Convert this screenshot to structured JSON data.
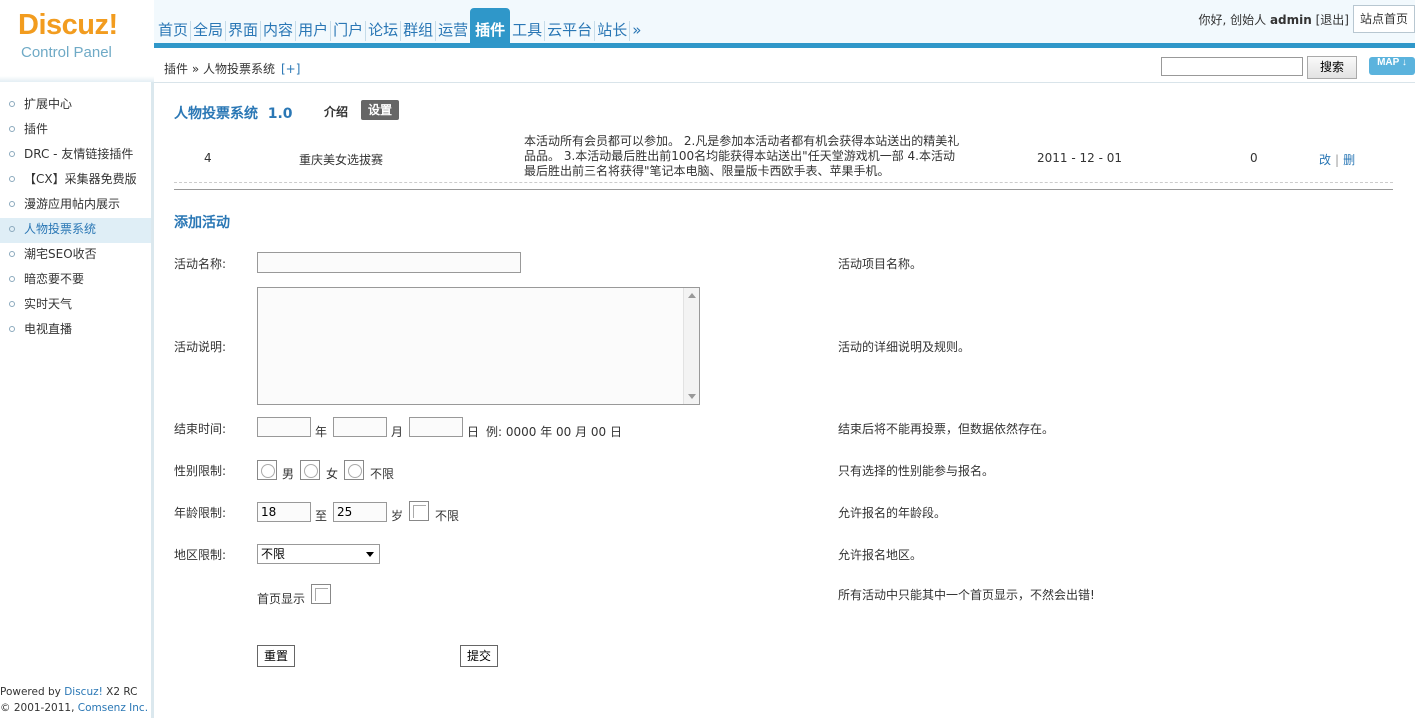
{
  "logo": {
    "brand": "Discuz!",
    "subtitle": "Control Panel"
  },
  "nav": {
    "items": [
      "首页",
      "全局",
      "界面",
      "内容",
      "用户",
      "门户",
      "论坛",
      "群组",
      "运营",
      "插件",
      "工具",
      "云平台",
      "站长",
      "»"
    ],
    "active": "插件"
  },
  "user": {
    "greeting": "你好, 创始人",
    "name": "admin",
    "logout": "[退出]",
    "site_home": "站点首页"
  },
  "breadcrumb": {
    "path": "插件 » 人物投票系统",
    "add": "[+]"
  },
  "search": {
    "value": "",
    "button": "搜索",
    "map": "MAP ↓"
  },
  "sidebar": {
    "items": [
      "扩展中心",
      "插件",
      "DRC - 友情链接插件",
      "【CX】采集器免费版",
      "漫游应用帖内展示",
      "人物投票系统",
      "潮宅SEO收否",
      "暗恋要不要",
      "实时天气",
      "电视直播"
    ],
    "active": "人物投票系统",
    "powered_prefix": "Powered by",
    "powered_brand": "Discuz!",
    "version": "X2 RC",
    "copyright": "© 2001-2011,",
    "company": "Comsenz Inc."
  },
  "plugin": {
    "title": "人物投票系统",
    "version": "1.0",
    "tab_intro": "介绍",
    "tab_settings": "设置"
  },
  "activity_row": {
    "id": "4",
    "name": "重庆美女选拔赛",
    "description_lines": [
      "本活动所有会员都可以参加。  2.凡是参加本活动者都有机会获得本站送出的精美礼",
      "品品。  3.本活动最后胜出前100名均能获得本站送出\"任天堂游戏机一部  4.本活动",
      "最后胜出前三名将获得\"笔记本电脑、限量版卡西欧手表、苹果手机。"
    ],
    "date": "2011 - 12 - 01",
    "count": "0",
    "edit": "改",
    "delete": "删"
  },
  "form": {
    "title": "添加活动",
    "name_label": "活动名称:",
    "name_tip": "活动项目名称。",
    "desc_label": "活动说明:",
    "desc_tip": "活动的详细说明及规则。",
    "end_label": "结束时间:",
    "year_unit": "年",
    "month_unit": "月",
    "day_unit": "日",
    "end_example": "例: 0000 年  00 月  00 日",
    "end_tip": "结束后将不能再投票，但数据依然存在。",
    "gender_label": "性别限制:",
    "gender_options": [
      "男",
      "女",
      "不限"
    ],
    "gender_tip": "只有选择的性别能参与报名。",
    "age_label": "年龄限制:",
    "age_min": "18",
    "age_to": "至",
    "age_max": "25",
    "age_unit": "岁",
    "age_unlimited": "不限",
    "age_tip": "允许报名的年龄段。",
    "region_label": "地区限制:",
    "region_value": "不限",
    "region_tip": "允许报名地区。",
    "homepage_label": "首页显示",
    "homepage_tip": "所有活动中只能其中一个首页显示，不然会出错!",
    "reset": "重置",
    "submit": "提交"
  },
  "colors": {
    "accent": "#2f97c9",
    "link": "#2a77b5",
    "logo": "#f29c1f"
  }
}
